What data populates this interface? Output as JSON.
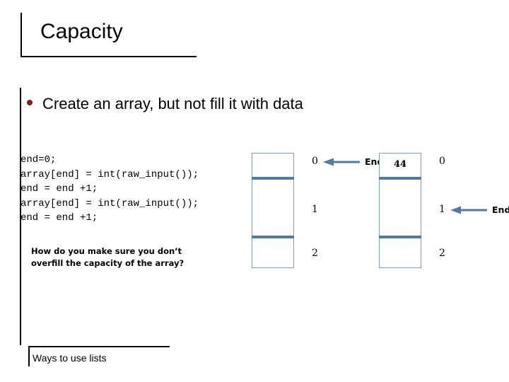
{
  "slide": {
    "title": "Capacity",
    "bullet": "Create an array, but not fill it with data",
    "code": "end=0;\narray[end] = int(raw_input());\nend = end +1;\narray[end] = int(raw_input());\nend = end +1;",
    "note": "How do you make sure you don’t\noverfill the capacity of the array?",
    "footer": "Ways to use lists"
  },
  "colors": {
    "divider_blue": "#517ba3",
    "box_border_blue": "#7d9dc0",
    "bullet_red": "#8b1a1a",
    "text_black": "#000000"
  },
  "diagrams": [
    {
      "name": "array-before",
      "cells": [
        "",
        "",
        ""
      ],
      "indices": [
        "0",
        "1",
        "2"
      ],
      "end_label": "End",
      "end_points_to_index": "0"
    },
    {
      "name": "array-after",
      "cells": [
        "44",
        "",
        ""
      ],
      "indices": [
        "0",
        "1",
        "2"
      ],
      "end_label": "End",
      "end_points_to_index": "1"
    }
  ]
}
